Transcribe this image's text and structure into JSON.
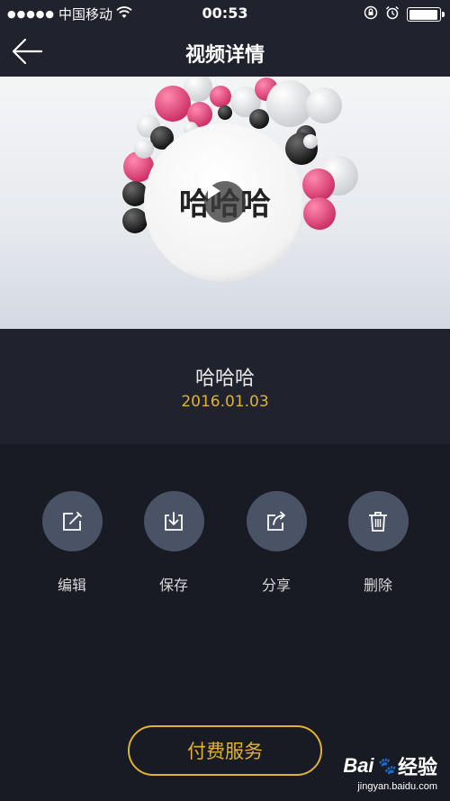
{
  "status_bar": {
    "signal_dots": "●●●●●",
    "carrier": "中国移动",
    "wifi_icon": "wifi-icon",
    "time": "00:53",
    "battery_level": 0.95
  },
  "nav": {
    "back_icon": "back-arrow-icon",
    "title": "视频详情"
  },
  "video": {
    "overlay_text": "哈哈哈",
    "play_icon": "play-icon"
  },
  "info": {
    "title": "哈哈哈",
    "date": "2016.01.03"
  },
  "actions": [
    {
      "label": "编辑",
      "icon": "edit-icon"
    },
    {
      "label": "保存",
      "icon": "download-icon"
    },
    {
      "label": "分享",
      "icon": "share-icon"
    },
    {
      "label": "删除",
      "icon": "trash-icon"
    }
  ],
  "pay_button": {
    "label": "付费服务"
  },
  "watermark": {
    "brand": "Bai",
    "brand_suffix": "经验",
    "url": "jingyan.baidu.com"
  },
  "colors": {
    "accent": "#e2b22e",
    "panel": "#20232d",
    "background": "#181b24",
    "action_circle": "#4a5365",
    "ball_pink": "#e8467c"
  }
}
